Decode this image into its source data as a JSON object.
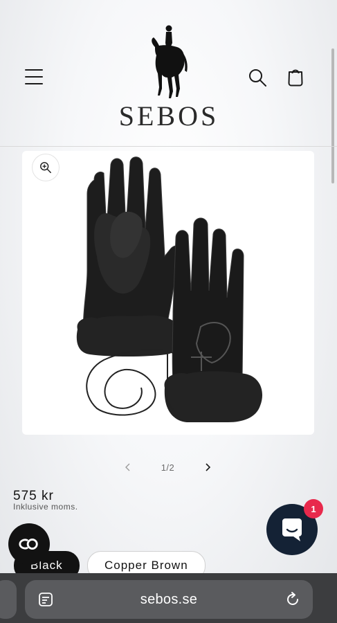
{
  "header": {
    "brand": "SEBOS",
    "menu_icon": "hamburger-icon",
    "search_icon": "search-icon",
    "cart_icon": "cart-icon"
  },
  "product": {
    "zoom_icon": "zoom-in-icon",
    "image_alt_icon": "gloves-image",
    "slider": {
      "counter": "1/2"
    },
    "price": "575 kr",
    "tax_note": "Inklusive moms.",
    "variants": [
      {
        "label": "Black",
        "selected": true
      },
      {
        "label": "Copper Brown",
        "selected": false
      }
    ]
  },
  "widgets": {
    "accessibility_icon": "accessibility-icon",
    "chat_icon": "chat-icon",
    "chat_badge": "1"
  },
  "browser": {
    "url": "sebos.se",
    "tabs_icon": "tabs-icon",
    "reload_icon": "reload-icon"
  },
  "colors": {
    "text": "#121212",
    "chat_bg": "#142235",
    "badge": "#e8294c",
    "browser_bar": "#3c3d3f"
  }
}
